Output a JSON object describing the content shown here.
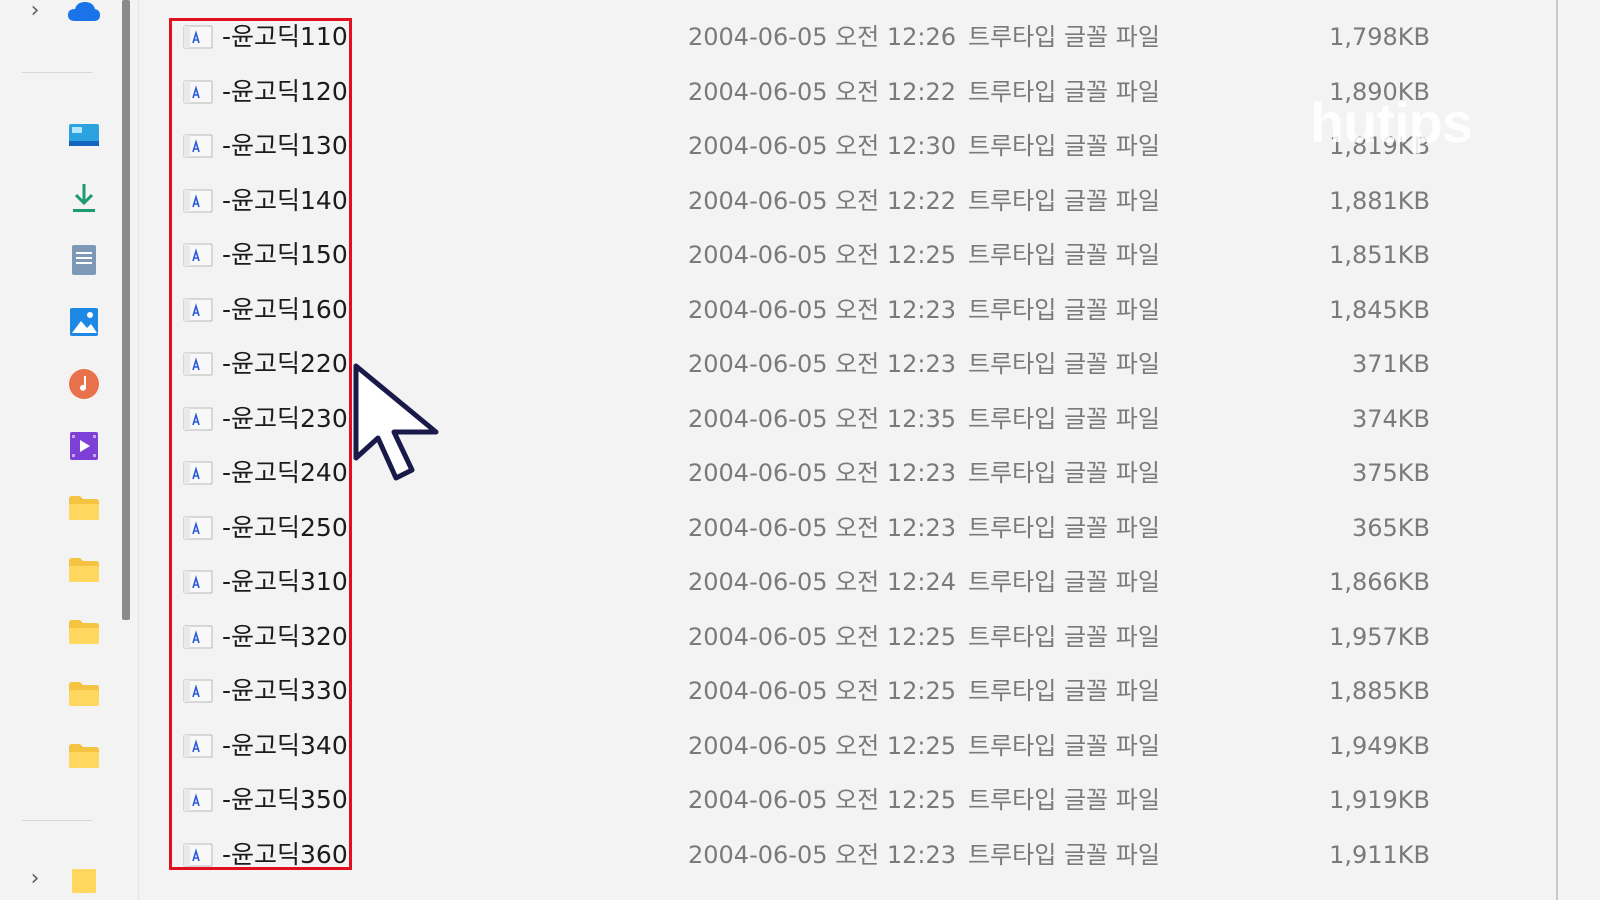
{
  "watermark": "hutips",
  "colors": {
    "highlight": "#e0101e",
    "name_text": "#1b1b1b",
    "meta_text": "#7a7a7a"
  },
  "nav": {
    "icons": [
      "onedrive-cloud-icon",
      "desktop-icon",
      "downloads-icon",
      "documents-icon",
      "pictures-icon",
      "music-icon",
      "videos-icon",
      "folder-icon",
      "folder-icon",
      "folder-icon",
      "folder-icon",
      "folder-icon",
      "folder-icon"
    ]
  },
  "files": [
    {
      "name": "-윤고딕110",
      "date": "2004-06-05 오전 12:26",
      "type": "트루타입 글꼴 파일",
      "size": "1,798KB"
    },
    {
      "name": "-윤고딕120",
      "date": "2004-06-05 오전 12:22",
      "type": "트루타입 글꼴 파일",
      "size": "1,890KB"
    },
    {
      "name": "-윤고딕130",
      "date": "2004-06-05 오전 12:30",
      "type": "트루타입 글꼴 파일",
      "size": "1,819KB"
    },
    {
      "name": "-윤고딕140",
      "date": "2004-06-05 오전 12:22",
      "type": "트루타입 글꼴 파일",
      "size": "1,881KB"
    },
    {
      "name": "-윤고딕150",
      "date": "2004-06-05 오전 12:25",
      "type": "트루타입 글꼴 파일",
      "size": "1,851KB"
    },
    {
      "name": "-윤고딕160",
      "date": "2004-06-05 오전 12:23",
      "type": "트루타입 글꼴 파일",
      "size": "1,845KB"
    },
    {
      "name": "-윤고딕220",
      "date": "2004-06-05 오전 12:23",
      "type": "트루타입 글꼴 파일",
      "size": "371KB"
    },
    {
      "name": "-윤고딕230",
      "date": "2004-06-05 오전 12:35",
      "type": "트루타입 글꼴 파일",
      "size": "374KB"
    },
    {
      "name": "-윤고딕240",
      "date": "2004-06-05 오전 12:23",
      "type": "트루타입 글꼴 파일",
      "size": "375KB"
    },
    {
      "name": "-윤고딕250",
      "date": "2004-06-05 오전 12:23",
      "type": "트루타입 글꼴 파일",
      "size": "365KB"
    },
    {
      "name": "-윤고딕310",
      "date": "2004-06-05 오전 12:24",
      "type": "트루타입 글꼴 파일",
      "size": "1,866KB"
    },
    {
      "name": "-윤고딕320",
      "date": "2004-06-05 오전 12:25",
      "type": "트루타입 글꼴 파일",
      "size": "1,957KB"
    },
    {
      "name": "-윤고딕330",
      "date": "2004-06-05 오전 12:25",
      "type": "트루타입 글꼴 파일",
      "size": "1,885KB"
    },
    {
      "name": "-윤고딕340",
      "date": "2004-06-05 오전 12:25",
      "type": "트루타입 글꼴 파일",
      "size": "1,949KB"
    },
    {
      "name": "-윤고딕350",
      "date": "2004-06-05 오전 12:25",
      "type": "트루타입 글꼴 파일",
      "size": "1,919KB"
    },
    {
      "name": "-윤고딕360",
      "date": "2004-06-05 오전 12:23",
      "type": "트루타입 글꼴 파일",
      "size": "1,911KB"
    }
  ]
}
